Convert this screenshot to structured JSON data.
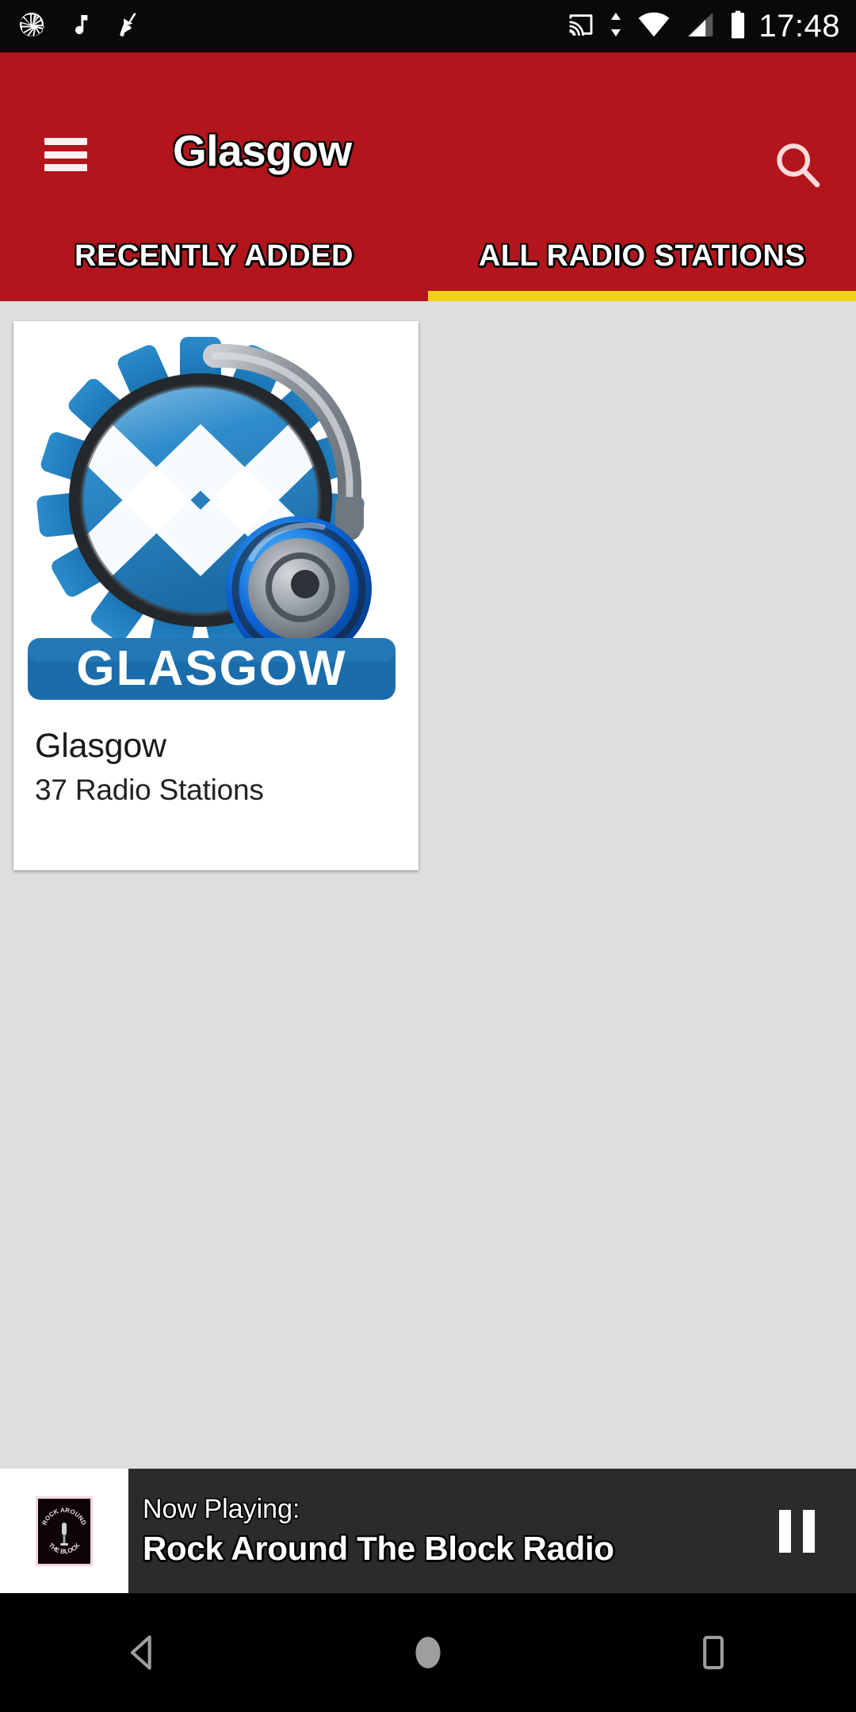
{
  "status_bar": {
    "time": "17:48",
    "left_icons": [
      "camera-aperture-icon",
      "music-note-icon",
      "broom-icon"
    ],
    "right_icons": [
      "cast-icon",
      "data-transfer-icon",
      "wifi-icon",
      "cellular-signal-icon",
      "battery-icon"
    ]
  },
  "app_bar": {
    "menu_icon": "hamburger-menu-icon",
    "title": "Glasgow",
    "search_icon": "search-icon",
    "background_color": "#B3151C"
  },
  "tabs": {
    "indicator_color": "#F2D01E",
    "items": [
      {
        "label": "RECENTLY ADDED",
        "active": false
      },
      {
        "label": "ALL RADIO STATIONS",
        "active": true
      }
    ]
  },
  "content": {
    "background_color": "#DEDEDE",
    "cards": [
      {
        "title": "Glasgow",
        "subtitle": "37 Radio Stations",
        "artwork": {
          "name": "glasgow-radio-logo",
          "banner_text": "GLASGOW",
          "primary_color": "#1572B8",
          "accent_color": "#1B6FAF",
          "flag": "scottish-saltire"
        }
      }
    ]
  },
  "now_playing": {
    "label": "Now Playing:",
    "title": "Rock Around The Block Radio",
    "artwork_name": "rock-around-the-block-thumbnail",
    "artwork_top_text": "ROCK AROUND",
    "artwork_bottom_text": "THE BLOCK",
    "control_icon": "pause-icon",
    "background_color": "#2B2B2B"
  },
  "nav_bar": {
    "back_icon": "back-triangle-icon",
    "home_icon": "home-circle-icon",
    "recents_icon": "recents-square-icon"
  }
}
